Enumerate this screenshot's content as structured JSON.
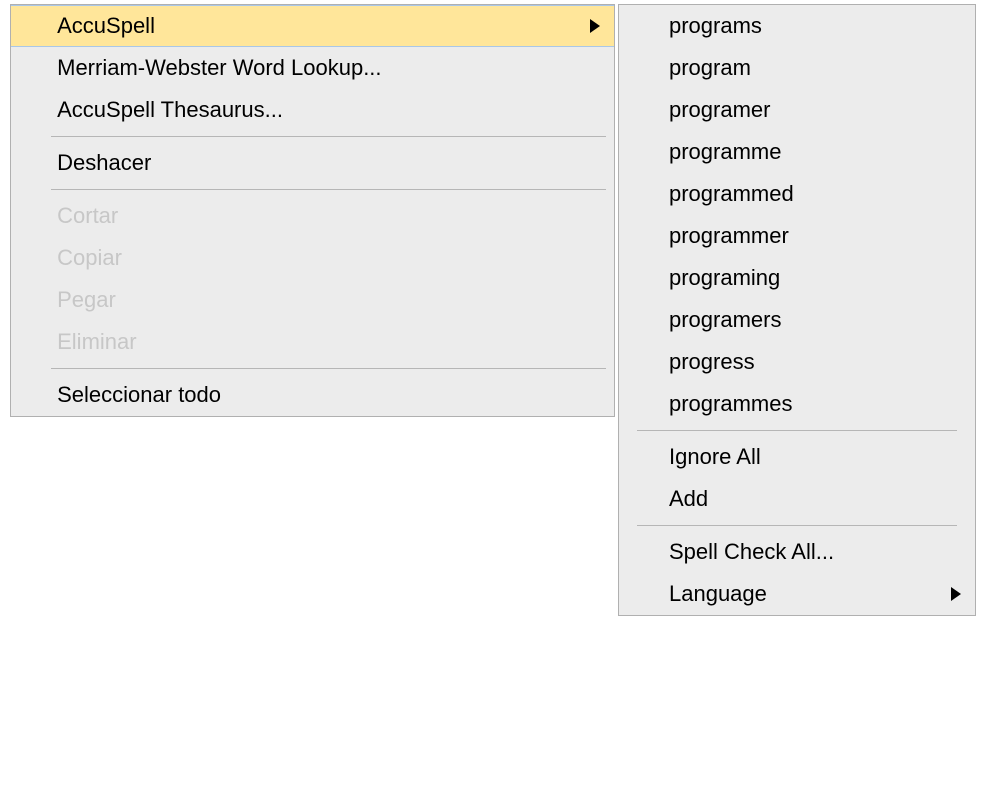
{
  "main_menu": {
    "accuspell": "AccuSpell",
    "merriam": "Merriam-Webster Word Lookup...",
    "thesaurus": "AccuSpell Thesaurus...",
    "undo": "Deshacer",
    "cut": "Cortar",
    "copy": "Copiar",
    "paste": "Pegar",
    "delete": "Eliminar",
    "select_all": "Seleccionar todo"
  },
  "sub_menu": {
    "suggestions": [
      "programs",
      "program",
      "programer",
      "programme",
      "programmed",
      "programmer",
      "programing",
      "programers",
      "progress",
      "programmes"
    ],
    "ignore_all": "Ignore All",
    "add": "Add",
    "spell_check_all": "Spell Check All...",
    "language": "Language"
  }
}
